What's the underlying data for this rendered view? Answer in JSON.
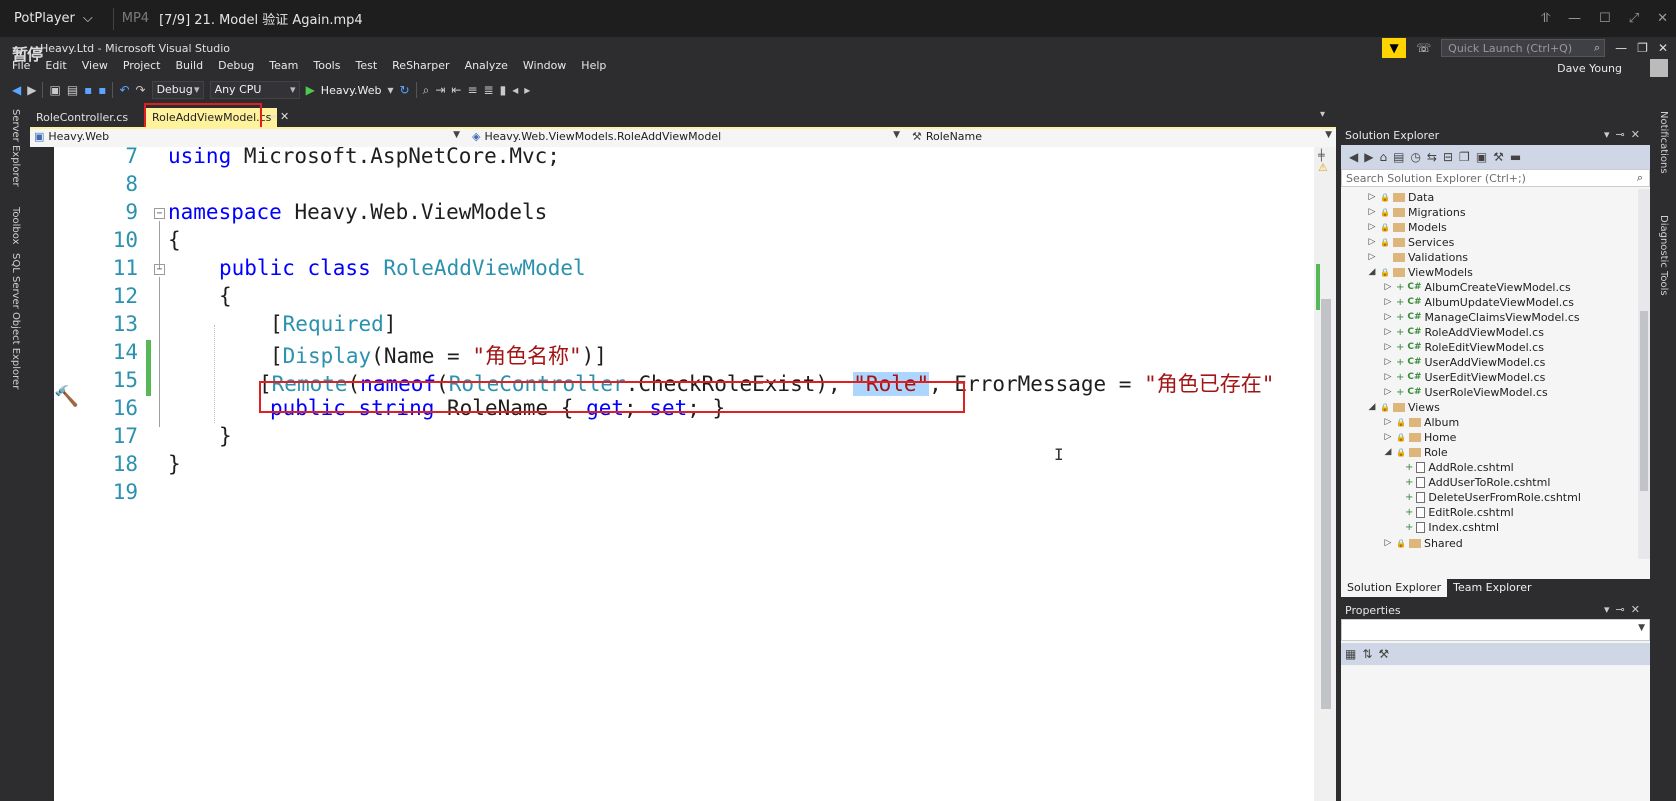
{
  "player": {
    "app": "PotPlayer",
    "format": "MP4",
    "title": "[7/9] 21. Model 验证 Again.mp4",
    "controls": [
      "pin-icon",
      "minimize-icon",
      "maximize-icon",
      "fullscreen-icon",
      "close-icon"
    ]
  },
  "vs": {
    "overlay_text": "暂停",
    "title": "Heavy.Ltd - Microsoft Visual Studio",
    "quick_launch_placeholder": "Quick Launch (Ctrl+Q)",
    "user": "Dave Young",
    "menu": [
      "File",
      "Edit",
      "View",
      "Project",
      "Build",
      "Debug",
      "Team",
      "Tools",
      "Test",
      "ReSharper",
      "Analyze",
      "Window",
      "Help"
    ],
    "toolbar": {
      "config": "Debug",
      "platform": "Any CPU",
      "run_target": "Heavy.Web"
    }
  },
  "left_tools": [
    "Server Explorer",
    "Toolbox",
    "SQL Server Object Explorer"
  ],
  "right_tools": [
    "Notifications",
    "Diagnostic Tools"
  ],
  "tabs": [
    {
      "label": "RoleController.cs",
      "active": false
    },
    {
      "label": "RoleAddViewModel.cs",
      "active": true
    }
  ],
  "navbar": {
    "project": "Heavy.Web",
    "type": "Heavy.Web.ViewModels.RoleAddViewModel",
    "member": "RoleName"
  },
  "code": {
    "lines": [
      {
        "n": "7"
      },
      {
        "n": "8"
      },
      {
        "n": "9"
      },
      {
        "n": "10"
      },
      {
        "n": "11"
      },
      {
        "n": "12"
      },
      {
        "n": "13"
      },
      {
        "n": "14"
      },
      {
        "n": "15"
      },
      {
        "n": "16"
      },
      {
        "n": "17"
      },
      {
        "n": "18"
      },
      {
        "n": "19"
      }
    ],
    "l7": {
      "kw": "using",
      "rest": " Microsoft.AspNetCore.Mvc;"
    },
    "l9": {
      "kw": "namespace",
      "rest": " Heavy.Web.ViewModels"
    },
    "l10": "{",
    "l11": {
      "kw1": "public",
      "kw2": " class",
      "ty": " RoleAddViewModel"
    },
    "l12": "{",
    "l13": {
      "open": "[",
      "ty": "Required",
      "close": "]"
    },
    "l14": {
      "open": "[",
      "ty": "Display",
      "mid": "(Name = ",
      "st": "\"角色名称\"",
      "close": ")]"
    },
    "l15": {
      "open": "[",
      "ty1": "Remote",
      "p1": "(",
      "kw": "nameof",
      "p2": "(",
      "ty2": "RoleController",
      "p3": ".CheckRoleExist), ",
      "st_sel": "\"Role\"",
      "p4": ", ErrorMessage = ",
      "st2": "\"角色已存在\""
    },
    "l16": {
      "kw1": "public",
      "kw2": " string",
      "rest": " RoleName { ",
      "kw3": "get",
      "semi1": "; ",
      "kw4": "set",
      "semi2": "; }"
    },
    "l17": "}",
    "l18": "}"
  },
  "solution_explorer": {
    "title": "Solution Explorer",
    "search_placeholder": "Search Solution Explorer (Ctrl+;)",
    "items": [
      {
        "label": "Data",
        "kind": "folder",
        "level": 0
      },
      {
        "label": "Migrations",
        "kind": "folder",
        "level": 0
      },
      {
        "label": "Models",
        "kind": "folder",
        "level": 0
      },
      {
        "label": "Services",
        "kind": "folder",
        "level": 0
      },
      {
        "label": "Validations",
        "kind": "folder",
        "level": 0
      },
      {
        "label": "ViewModels",
        "kind": "folder-open",
        "level": 0
      },
      {
        "label": "AlbumCreateViewModel.cs",
        "kind": "cs",
        "level": 1
      },
      {
        "label": "AlbumUpdateViewModel.cs",
        "kind": "cs",
        "level": 1
      },
      {
        "label": "ManageClaimsViewModel.cs",
        "kind": "cs",
        "level": 1
      },
      {
        "label": "RoleAddViewModel.cs",
        "kind": "cs",
        "level": 1
      },
      {
        "label": "RoleEditViewModel.cs",
        "kind": "cs",
        "level": 1
      },
      {
        "label": "UserAddViewModel.cs",
        "kind": "cs",
        "level": 1
      },
      {
        "label": "UserEditViewModel.cs",
        "kind": "cs",
        "level": 1
      },
      {
        "label": "UserRoleViewModel.cs",
        "kind": "cs",
        "level": 1
      },
      {
        "label": "Views",
        "kind": "folder-open",
        "level": 0
      },
      {
        "label": "Album",
        "kind": "folder",
        "level": 1
      },
      {
        "label": "Home",
        "kind": "folder",
        "level": 1
      },
      {
        "label": "Role",
        "kind": "folder-open",
        "level": 1
      },
      {
        "label": "AddRole.cshtml",
        "kind": "html",
        "level": 2
      },
      {
        "label": "AddUserToRole.cshtml",
        "kind": "html",
        "level": 2
      },
      {
        "label": "DeleteUserFromRole.cshtml",
        "kind": "html",
        "level": 2
      },
      {
        "label": "EditRole.cshtml",
        "kind": "html",
        "level": 2
      },
      {
        "label": "Index.cshtml",
        "kind": "html",
        "level": 2
      },
      {
        "label": "Shared",
        "kind": "folder",
        "level": 1
      }
    ],
    "tabs": [
      "Solution Explorer",
      "Team Explorer"
    ]
  },
  "properties": {
    "title": "Properties"
  },
  "colors": {
    "active_tab": "#fff29d",
    "highlight_box": "#e02020",
    "selection": "#add6ff"
  }
}
